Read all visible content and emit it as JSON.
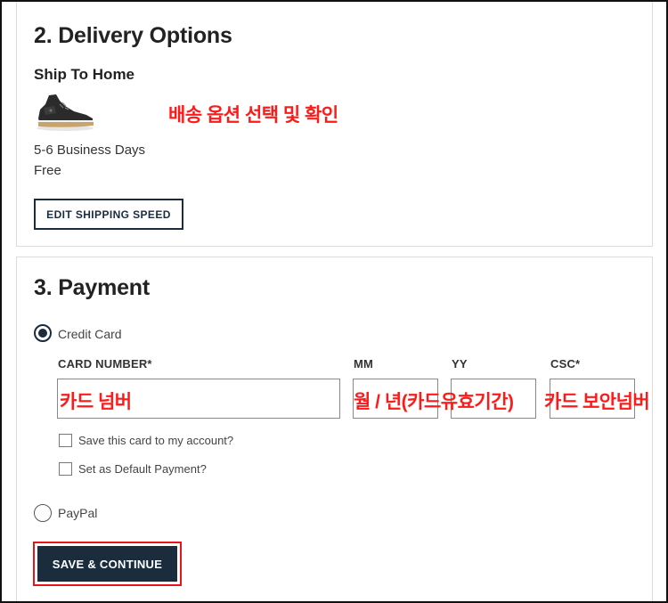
{
  "delivery": {
    "title": "2. Delivery Options",
    "method": "Ship To Home",
    "product_icon": "sneaker-image",
    "eta": "5-6 Business Days",
    "price": "Free",
    "edit_button": "EDIT SHIPPING SPEED",
    "annotation": "배송 옵션 선택 및 확인"
  },
  "payment": {
    "title": "3. Payment",
    "credit_card_label": "Credit Card",
    "credit_card_selected": true,
    "card_number_label": "CARD NUMBER*",
    "mm_label": "MM",
    "yy_label": "YY",
    "csc_label": "CSC*",
    "annotations": {
      "card_number": "카드 넘버",
      "expiry": "월 / 년(카드유효기간)",
      "csc": "카드 보안넘버"
    },
    "save_card_label": "Save this card to my account?",
    "default_payment_label": "Set as Default Payment?",
    "paypal_label": "PayPal",
    "continue_button": "SAVE & CONTINUE"
  },
  "colors": {
    "primary": "#1b2c3d",
    "annotation": "#ff1a1a"
  }
}
